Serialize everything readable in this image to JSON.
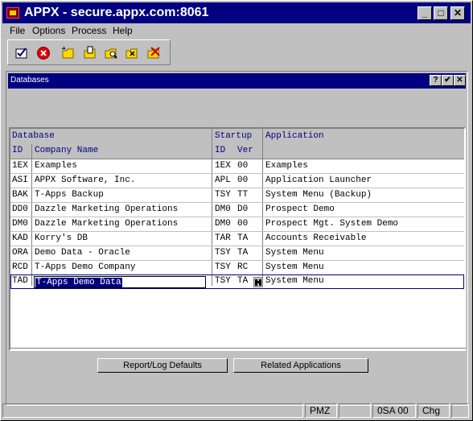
{
  "window": {
    "title": "APPX - secure.appx.com:8061"
  },
  "menu": [
    "File",
    "Options",
    "Process",
    "Help"
  ],
  "toolbar": {
    "icons": [
      "check-edit-icon",
      "cancel-icon",
      "new-record-icon",
      "open-record-icon",
      "find-record-icon",
      "clear-record-icon",
      "delete-record-icon"
    ]
  },
  "dialog": {
    "title": "Databases",
    "controls": {
      "help": "?",
      "ok": "✔",
      "close": "✕"
    }
  },
  "grid": {
    "headers": {
      "database": "Database",
      "startup": "Startup",
      "application": "Application",
      "id": "ID",
      "company_name": "Company Name",
      "startup_id": "ID",
      "ver": "Ver"
    },
    "rows": [
      {
        "id": "1EX",
        "company": "Examples",
        "sid": "1EX",
        "ver": "00",
        "app": "Examples"
      },
      {
        "id": "ASI",
        "company": "APPX Software, Inc.",
        "sid": "APL",
        "ver": "00",
        "app": "Application Launcher"
      },
      {
        "id": "BAK",
        "company": "T-Apps Backup",
        "sid": "TSY",
        "ver": "TT",
        "app": "System Menu (Backup)"
      },
      {
        "id": "DD0",
        "company": "Dazzle Marketing Operations",
        "sid": "DM0",
        "ver": "D0",
        "app": "Prospect Demo"
      },
      {
        "id": "DM0",
        "company": "Dazzle Marketing Operations",
        "sid": "DM0",
        "ver": "00",
        "app": "Prospect Mgt. System Demo"
      },
      {
        "id": "KAD",
        "company": "Korry's DB",
        "sid": "TAR",
        "ver": "TA",
        "app": "Accounts Receivable"
      },
      {
        "id": "ORA",
        "company": "Demo Data - Oracle",
        "sid": "TSY",
        "ver": "TA",
        "app": "System Menu"
      },
      {
        "id": "RCD",
        "company": "T-Apps Demo Company",
        "sid": "TSY",
        "ver": "RC",
        "app": "System Menu"
      },
      {
        "id": "TAD",
        "company": "T-Apps Demo Data",
        "sid": "TSY",
        "ver": "TA",
        "app": "System Menu"
      }
    ]
  },
  "buttons": {
    "report_log": "Report/Log Defaults",
    "related_apps": "Related Applications"
  },
  "status": {
    "user": "PMZ",
    "code": "0SA 00",
    "mode": "Chg"
  }
}
